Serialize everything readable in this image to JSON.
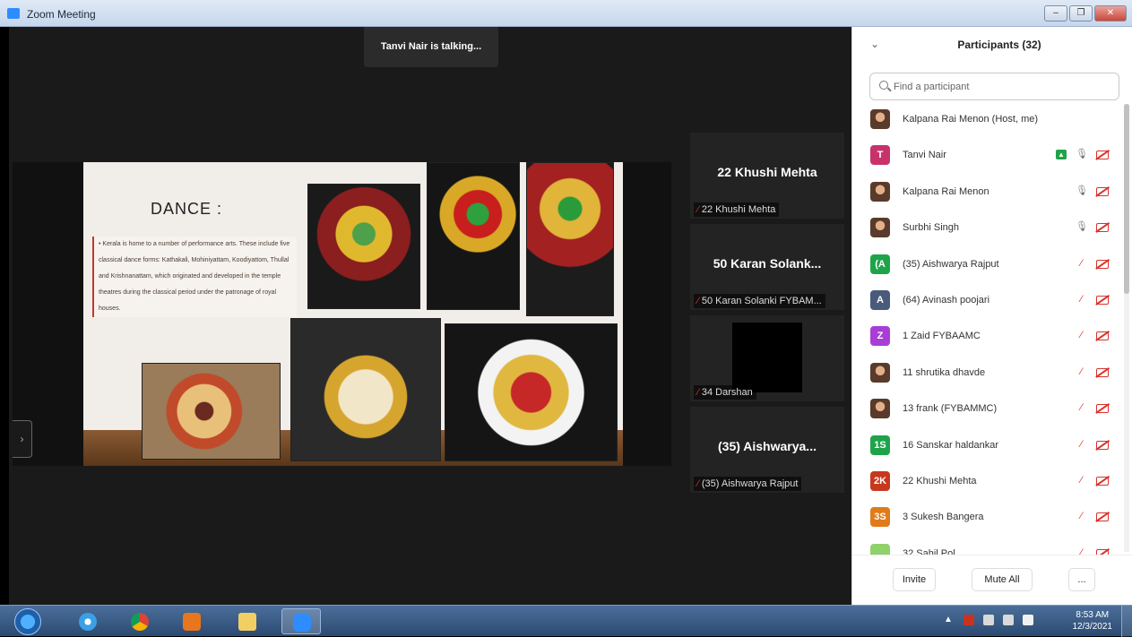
{
  "window": {
    "title": "Zoom Meeting",
    "buttons": [
      "‒",
      "❐",
      "✕"
    ]
  },
  "meeting": {
    "talking_indicator": "Tanvi Nair is talking...",
    "slide": {
      "title": "DANCE :",
      "text": "• Kerala is home to a number of performance arts. These include five classical dance forms: Kathakali, Mohiniyattam, Koodiyattom, Thullal and Krishnanattam, which originated and developed in the temple theatres during the classical period under the patronage of royal houses."
    },
    "side_tab_glyph": "›",
    "tiles": [
      {
        "name": "22 Khushi Mehta",
        "label": "22 Khushi Mehta"
      },
      {
        "name": "50 Karan Solank...",
        "label": "50 Karan Solanki FYBAM..."
      },
      {
        "name": "",
        "label": "34 Darshan"
      },
      {
        "name": "(35) Aishwarya...",
        "label": "(35) Aishwarya Rajput"
      }
    ]
  },
  "participants": {
    "title": "Participants (32)",
    "search_placeholder": "Find a participant",
    "list": [
      {
        "name": "Kalpana Rai Menon (Host, me)",
        "initials": "",
        "color": "",
        "mic": "none",
        "cam": "none"
      },
      {
        "name": "Tanvi Nair",
        "initials": "T",
        "color": "#c8326a",
        "mic": "on",
        "cam": "off",
        "sharing": true
      },
      {
        "name": "Kalpana Rai Menon",
        "initials": "",
        "color": "",
        "mic": "on",
        "cam": "off"
      },
      {
        "name": "Surbhi Singh",
        "initials": "",
        "color": "",
        "mic": "on",
        "cam": "off"
      },
      {
        "name": "(35) Aishwarya Rajput",
        "initials": "(A",
        "color": "#1fa34a",
        "mic": "off",
        "cam": "off"
      },
      {
        "name": "(64) Avinash poojari",
        "initials": "A",
        "color": "#4a5a7a",
        "mic": "off",
        "cam": "off"
      },
      {
        "name": "1 Zaid FYBAAMC",
        "initials": "Z",
        "color": "#a83ed6",
        "mic": "off",
        "cam": "off"
      },
      {
        "name": "11 shrutika dhavde",
        "initials": "",
        "color": "",
        "mic": "off",
        "cam": "off"
      },
      {
        "name": "13 frank (FYBAMMC)",
        "initials": "",
        "color": "",
        "mic": "off",
        "cam": "off"
      },
      {
        "name": "16 Sanskar haldankar",
        "initials": "1S",
        "color": "#1fa34a",
        "mic": "off",
        "cam": "off"
      },
      {
        "name": "22 Khushi Mehta",
        "initials": "2K",
        "color": "#c7391e",
        "mic": "off",
        "cam": "off"
      },
      {
        "name": "3 Sukesh Bangera",
        "initials": "3S",
        "color": "#e07b1a",
        "mic": "off",
        "cam": "off"
      },
      {
        "name": "32 Sahil Pol",
        "initials": "",
        "color": "#8fd16a",
        "mic": "off",
        "cam": "off"
      }
    ],
    "footer": {
      "invite": "Invite",
      "mute_all": "Mute All",
      "more": "..."
    }
  },
  "taskbar": {
    "apps": [
      "internet-explorer-icon",
      "chrome-icon",
      "media-player-icon",
      "file-explorer-icon",
      "zoom-icon"
    ],
    "clock_time": "8:53 AM",
    "clock_date": "12/3/2021"
  }
}
